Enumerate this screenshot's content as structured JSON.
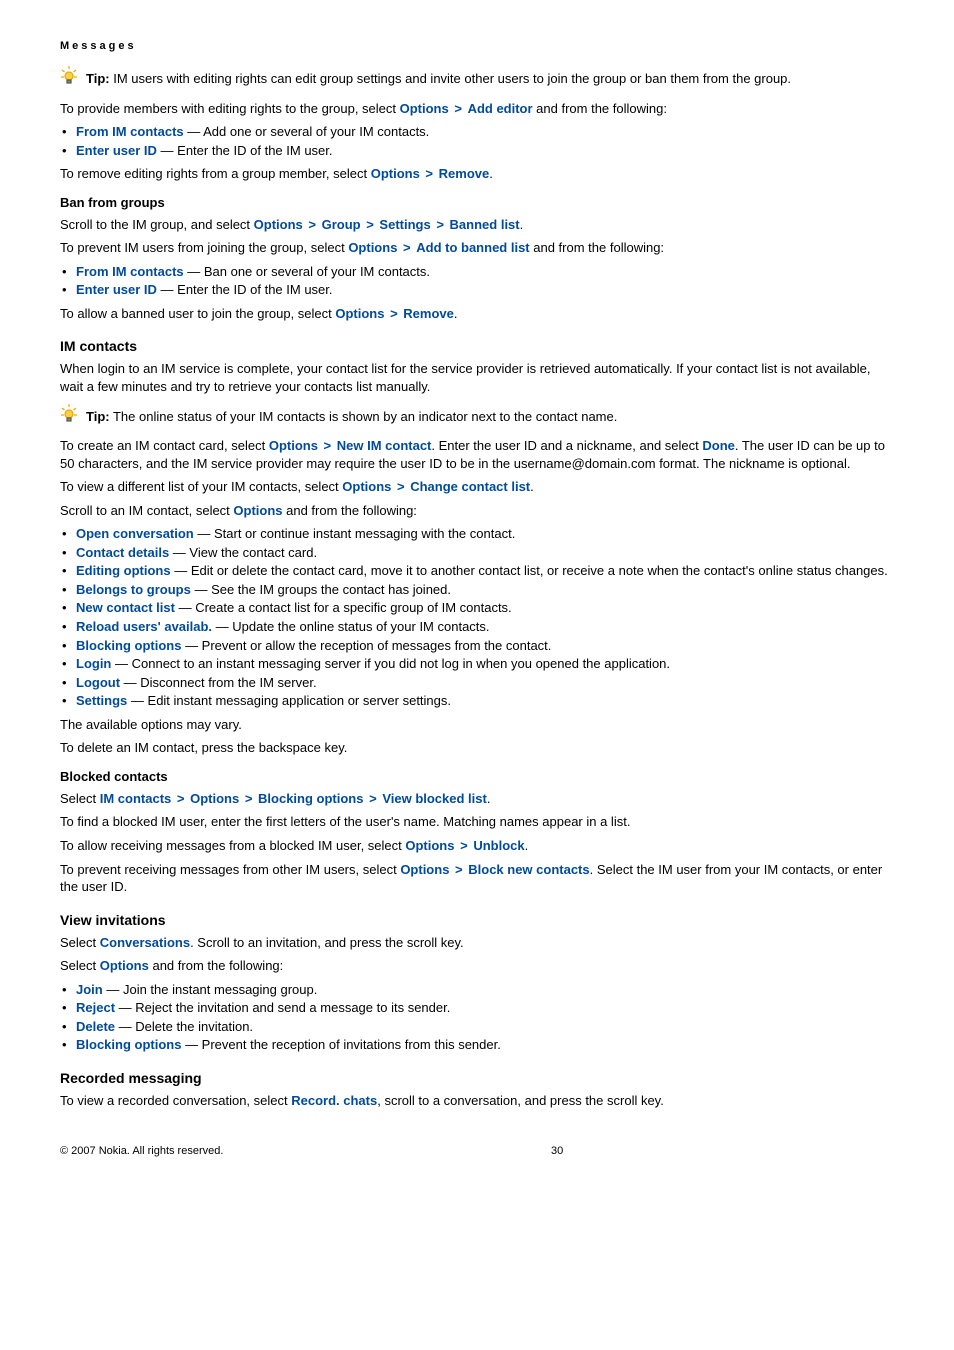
{
  "header": {
    "breadcrumb": "Messages"
  },
  "tip1": {
    "label": "Tip:",
    "text": " IM users with editing rights can edit group settings and invite other users to join the group or ban them from the group."
  },
  "p_editrights": {
    "t1": "To provide members with editing rights to the group, select ",
    "options": "Options",
    "addeditor": "Add editor",
    "t2": " and from the following:"
  },
  "editrights_items": [
    {
      "link": "From IM contacts",
      "text": " — Add one or several of your IM contacts."
    },
    {
      "link": "Enter user ID",
      "text": " — Enter the ID of the IM user."
    }
  ],
  "p_removerights": {
    "t1": "To remove editing rights from a group member, select ",
    "options": "Options",
    "remove": "Remove",
    "dot": "."
  },
  "ban_h": "Ban from groups",
  "p_scrollim": {
    "t1": "Scroll to the IM group, and select ",
    "options": "Options",
    "group": "Group",
    "settings": "Settings",
    "banned": "Banned list",
    "dot": "."
  },
  "p_prevent": {
    "t1": "To prevent IM users from joining the group, select ",
    "options": "Options",
    "add": "Add to banned list",
    "t2": " and from the following:"
  },
  "ban_items": [
    {
      "link": "From IM contacts",
      "text": " — Ban one or several of your IM contacts."
    },
    {
      "link": "Enter user ID",
      "text": " — Enter the ID of the IM user."
    }
  ],
  "p_allowbanned": {
    "t1": "To allow a banned user to join the group, select ",
    "options": "Options",
    "remove": "Remove",
    "dot": "."
  },
  "imcontacts_h": "IM contacts",
  "p_login": "When login to an IM service is complete, your contact list for the service provider is retrieved automatically. If your contact list is not available, wait a few minutes and try to retrieve your contacts list manually.",
  "tip2": {
    "label": "Tip:",
    "text": " The online status of your IM contacts is shown by an indicator next to the contact name."
  },
  "p_createcard": {
    "t1": "To create an IM contact card, select ",
    "options": "Options",
    "newim": "New IM contact",
    "t2": ". Enter the user ID and a nickname, and select ",
    "done": "Done",
    "t3": ". The user ID can be up to 50 characters, and the IM service provider may require the user ID to be in the username@domain.com format. The nickname is optional."
  },
  "p_viewlist": {
    "t1": "To view a different list of your IM contacts, select ",
    "options": "Options",
    "change": "Change contact list",
    "dot": "."
  },
  "p_scrollcontact": {
    "t1": "Scroll to an IM contact, select ",
    "options": "Options",
    "t2": " and from the following:"
  },
  "contact_items": [
    {
      "link": "Open conversation",
      "text": " — Start or continue instant messaging with the contact."
    },
    {
      "link": "Contact details",
      "text": " — View the contact card."
    },
    {
      "link": "Editing options",
      "text": " — Edit or delete the contact card, move it to another contact list, or receive a note when the contact's online status changes."
    },
    {
      "link": "Belongs to groups",
      "text": " — See the IM groups the contact has joined."
    },
    {
      "link": "New contact list",
      "text": " — Create a contact list for a specific group of IM contacts."
    },
    {
      "link": "Reload users' availab.",
      "text": " — Update the online status of your IM contacts."
    },
    {
      "link": "Blocking options",
      "text": " — Prevent or allow the reception of messages from the contact."
    },
    {
      "link": "Login",
      "text": " — Connect to an instant messaging server if you did not log in when you opened the application."
    },
    {
      "link": "Logout",
      "text": " — Disconnect from the IM server."
    },
    {
      "link": "Settings",
      "text": " — Edit instant messaging application or server settings."
    }
  ],
  "p_avail": "The available options may vary.",
  "p_delete": "To delete an IM contact, press the backspace key.",
  "blocked_h": "Blocked contacts",
  "p_selectblocked": {
    "t1": "Select ",
    "im": "IM contacts",
    "options": "Options",
    "block": "Blocking options",
    "view": "View blocked list",
    "dot": "."
  },
  "p_findblocked": "To find a blocked IM user, enter the first letters of the user's name. Matching names appear in a list.",
  "p_allowrecv": {
    "t1": "To allow receiving messages from a blocked IM user, select ",
    "options": "Options",
    "unblock": "Unblock",
    "dot": "."
  },
  "p_preventrecv": {
    "t1": "To prevent receiving messages from other IM users, select ",
    "options": "Options",
    "blocknew": "Block new contacts",
    "t2": ". Select the IM user from your IM contacts, or enter the user ID."
  },
  "viewinv_h": "View invitations",
  "p_selectconv": {
    "t1": "Select ",
    "conv": "Conversations",
    "t2": ". Scroll to an invitation, and press the scroll key."
  },
  "p_selectopt": {
    "t1": "Select ",
    "options": "Options",
    "t2": " and from the following:"
  },
  "inv_items": [
    {
      "link": "Join",
      "text": " — Join the instant messaging group."
    },
    {
      "link": "Reject",
      "text": " — Reject the invitation and send a message to its sender."
    },
    {
      "link": "Delete",
      "text": " — Delete the invitation."
    },
    {
      "link": "Blocking options",
      "text": " — Prevent the reception of invitations from this sender."
    }
  ],
  "recorded_h": "Recorded messaging",
  "p_recorded": {
    "t1": "To view a recorded conversation, select ",
    "rec": "Record. chats",
    "t2": ", scroll to a conversation, and press the scroll key."
  },
  "footer": {
    "copyright": "© 2007 Nokia. All rights reserved.",
    "page": "30"
  }
}
